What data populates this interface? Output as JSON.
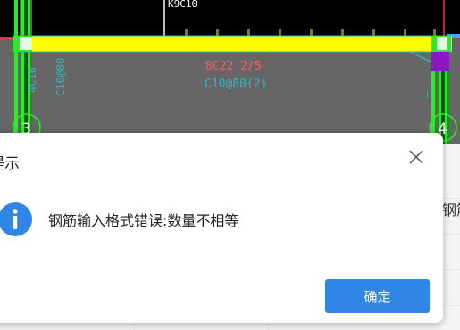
{
  "cad": {
    "top_label": "K9C10",
    "beam_label_1": "8C22 2/5",
    "beam_label_2": "C10@80(2)",
    "left_vert_label_1": "4C16",
    "left_vert_label_2": "C10@80",
    "axis_left": "3",
    "axis_right": "4"
  },
  "background": {
    "partial_text": "钢筋"
  },
  "dialog": {
    "title": "提示",
    "message": "钢筋输入格式错误:数量不相等",
    "ok_label": "确定"
  },
  "colors": {
    "cad_background": "#666666",
    "beam": "#ffff00",
    "column": "#2ee82e",
    "annotation_red": "#ff5a5a",
    "annotation_cyan": "#2bb7c7",
    "button": "#2f86e5",
    "info_icon": "#2f86e5"
  }
}
